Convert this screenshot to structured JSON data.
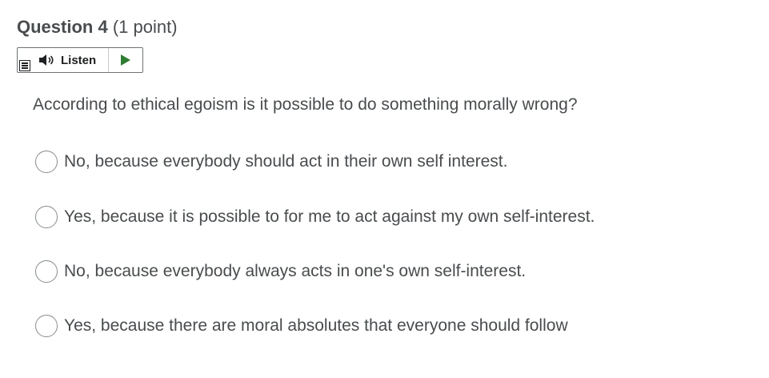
{
  "question": {
    "title": "Question 4",
    "points": "(1 point)",
    "prompt": "According to ethical egoism is it possible to do something morally wrong?"
  },
  "listen": {
    "label": "Listen",
    "icons": {
      "menu": "menu-icon",
      "speaker": "speaker-icon",
      "play": "play-icon"
    },
    "play_color": "#2e7d32"
  },
  "choices": [
    {
      "label": "No, because everybody should act in their own self interest.",
      "selected": false
    },
    {
      "label": "Yes, because it is possible to for me to act against my own self-interest.",
      "selected": false
    },
    {
      "label": "No, because everybody always acts in one's own self-interest.",
      "selected": false
    },
    {
      "label": "Yes, because there are moral absolutes that everyone should follow",
      "selected": false
    }
  ]
}
